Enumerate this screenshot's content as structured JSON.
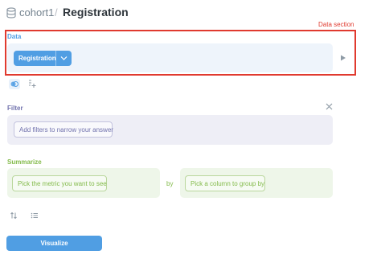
{
  "header": {
    "parent": "cohort1",
    "separator": "/",
    "title": "Registration",
    "db_icon": "database-icon"
  },
  "annotation": {
    "label": "Data section",
    "color": "#e03a2f"
  },
  "data_section": {
    "label": "Data",
    "table_button_label": "Registration",
    "color": "#509ee3",
    "icons": [
      "chevron-down-icon",
      "play-icon",
      "join-icon",
      "custom-column-icon"
    ]
  },
  "filter_section": {
    "label": "Filter",
    "placeholder_pill": "Add filters to narrow your answer",
    "color": "#7172ad",
    "close_icon": "close-icon"
  },
  "summarize_section": {
    "label": "Summarize",
    "metric_pill": "Pick the metric you want to see",
    "by_text": "by",
    "group_pill": "Pick a column to group by",
    "color": "#84bb4c"
  },
  "extra_steps": {
    "icons": [
      "sort-icon",
      "limit-icon"
    ]
  },
  "visualize": {
    "label": "Visualize"
  }
}
